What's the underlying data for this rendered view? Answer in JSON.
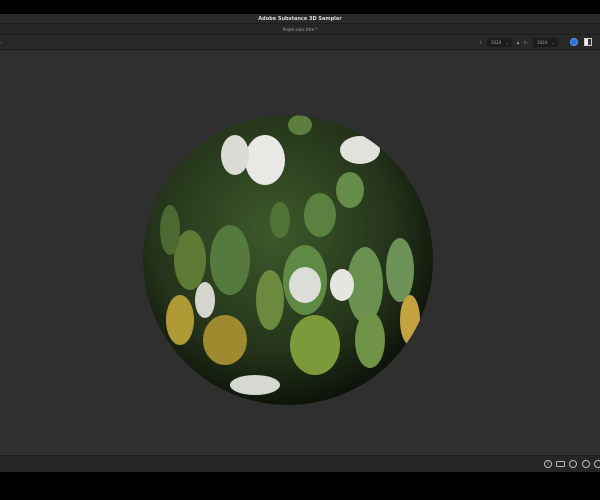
{
  "window": {
    "title": "Adobe Substance 3D Sampler",
    "project": "Projet sans titre *"
  },
  "toolbar": {
    "width_label": "l:",
    "width_value": "1024",
    "height_label": "h:",
    "height_value": "1024",
    "lock_icon": "lock-icon",
    "view_3d_icon": "cube-icon",
    "view_2d_icon": "checker-icon"
  },
  "viewport": {
    "background": "#2f2f2f",
    "object": "sphere"
  },
  "bottombar": {
    "icons": [
      "info-icon",
      "camera-icon",
      "rotate-icon",
      "zoom-icon",
      "reset-icon"
    ]
  }
}
